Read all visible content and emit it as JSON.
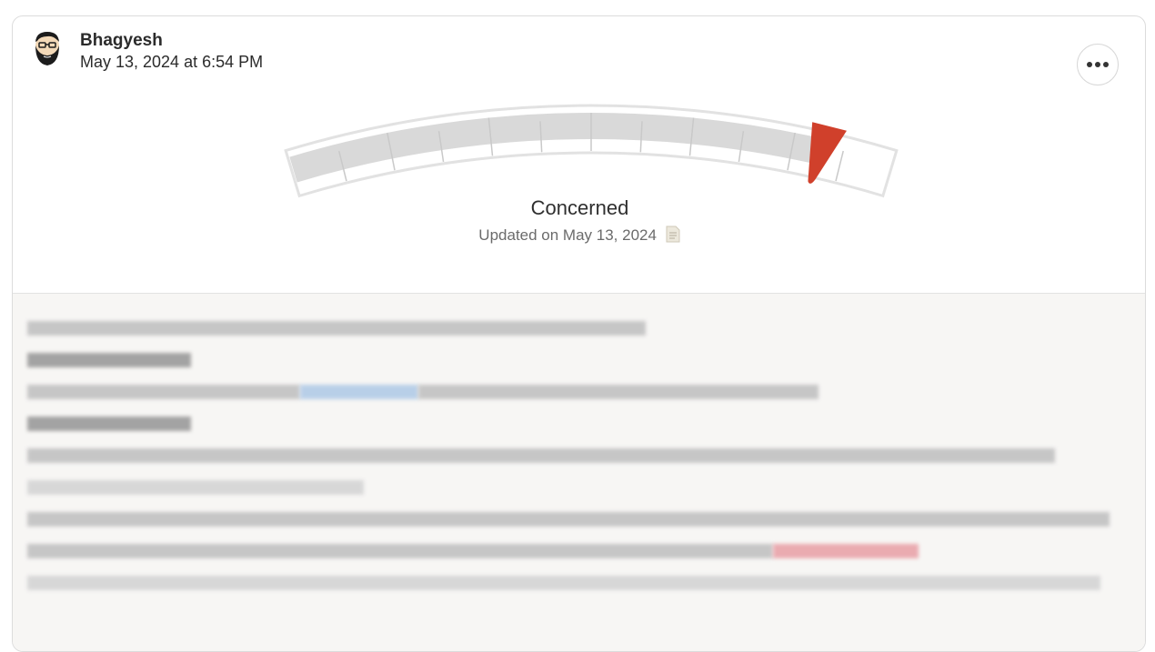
{
  "post": {
    "author_name": "Bhagyesh",
    "timestamp": "May 13, 2024 at 6:54 PM",
    "avatar_icon": "bearded-man-avatar",
    "more_icon": "more-horizontal-icon"
  },
  "status": {
    "label": "Concerned",
    "updated_text": "Updated on May 13, 2024",
    "note_icon": "note-icon",
    "gauge_level": 0.88,
    "needle_color": "#d0402b",
    "fill_color": "#d9d9d9"
  },
  "content": {
    "obscured": true
  }
}
